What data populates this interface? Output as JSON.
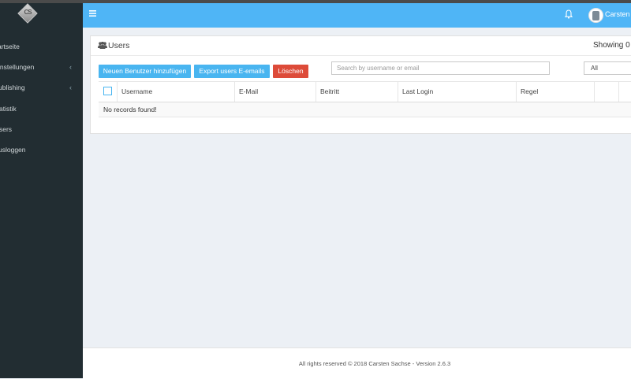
{
  "sidebar": {
    "logo_text": "CS",
    "items": [
      {
        "label": "artseite",
        "has_chevron": false
      },
      {
        "label": "instellungen",
        "has_chevron": true
      },
      {
        "label": "ublishing",
        "has_chevron": true
      },
      {
        "label": "atistik",
        "has_chevron": false
      },
      {
        "label": "sers",
        "has_chevron": false
      },
      {
        "label": "usloggen",
        "has_chevron": false
      }
    ],
    "chevron": "‹"
  },
  "header": {
    "menu_icon": "hamburger-icon",
    "notifications_icon": "bell-icon",
    "user_name": "Carsten S",
    "accent_color": "#4fb5f6"
  },
  "panel": {
    "title": "Users",
    "title_icon": "users-icon",
    "showing": "Showing 0"
  },
  "toolbar": {
    "add_user_label": "Neuen Benutzer hinzufügen",
    "export_label": "Export users E-emails",
    "delete_label": "Löschen",
    "search_placeholder": "Search by username or email",
    "filter_value": "All"
  },
  "table": {
    "columns": [
      "Username",
      "E-Mail",
      "Beitritt",
      "Last Login",
      "Regel",
      "",
      ""
    ],
    "empty_message": "No records found!"
  },
  "footer": {
    "text": "All rights reserved © 2018 Carsten Sachse - Version 2.6.3"
  },
  "colors": {
    "sidebar": "#222d32",
    "button_blue": "#49b5f0",
    "button_red": "#dd4b39"
  }
}
